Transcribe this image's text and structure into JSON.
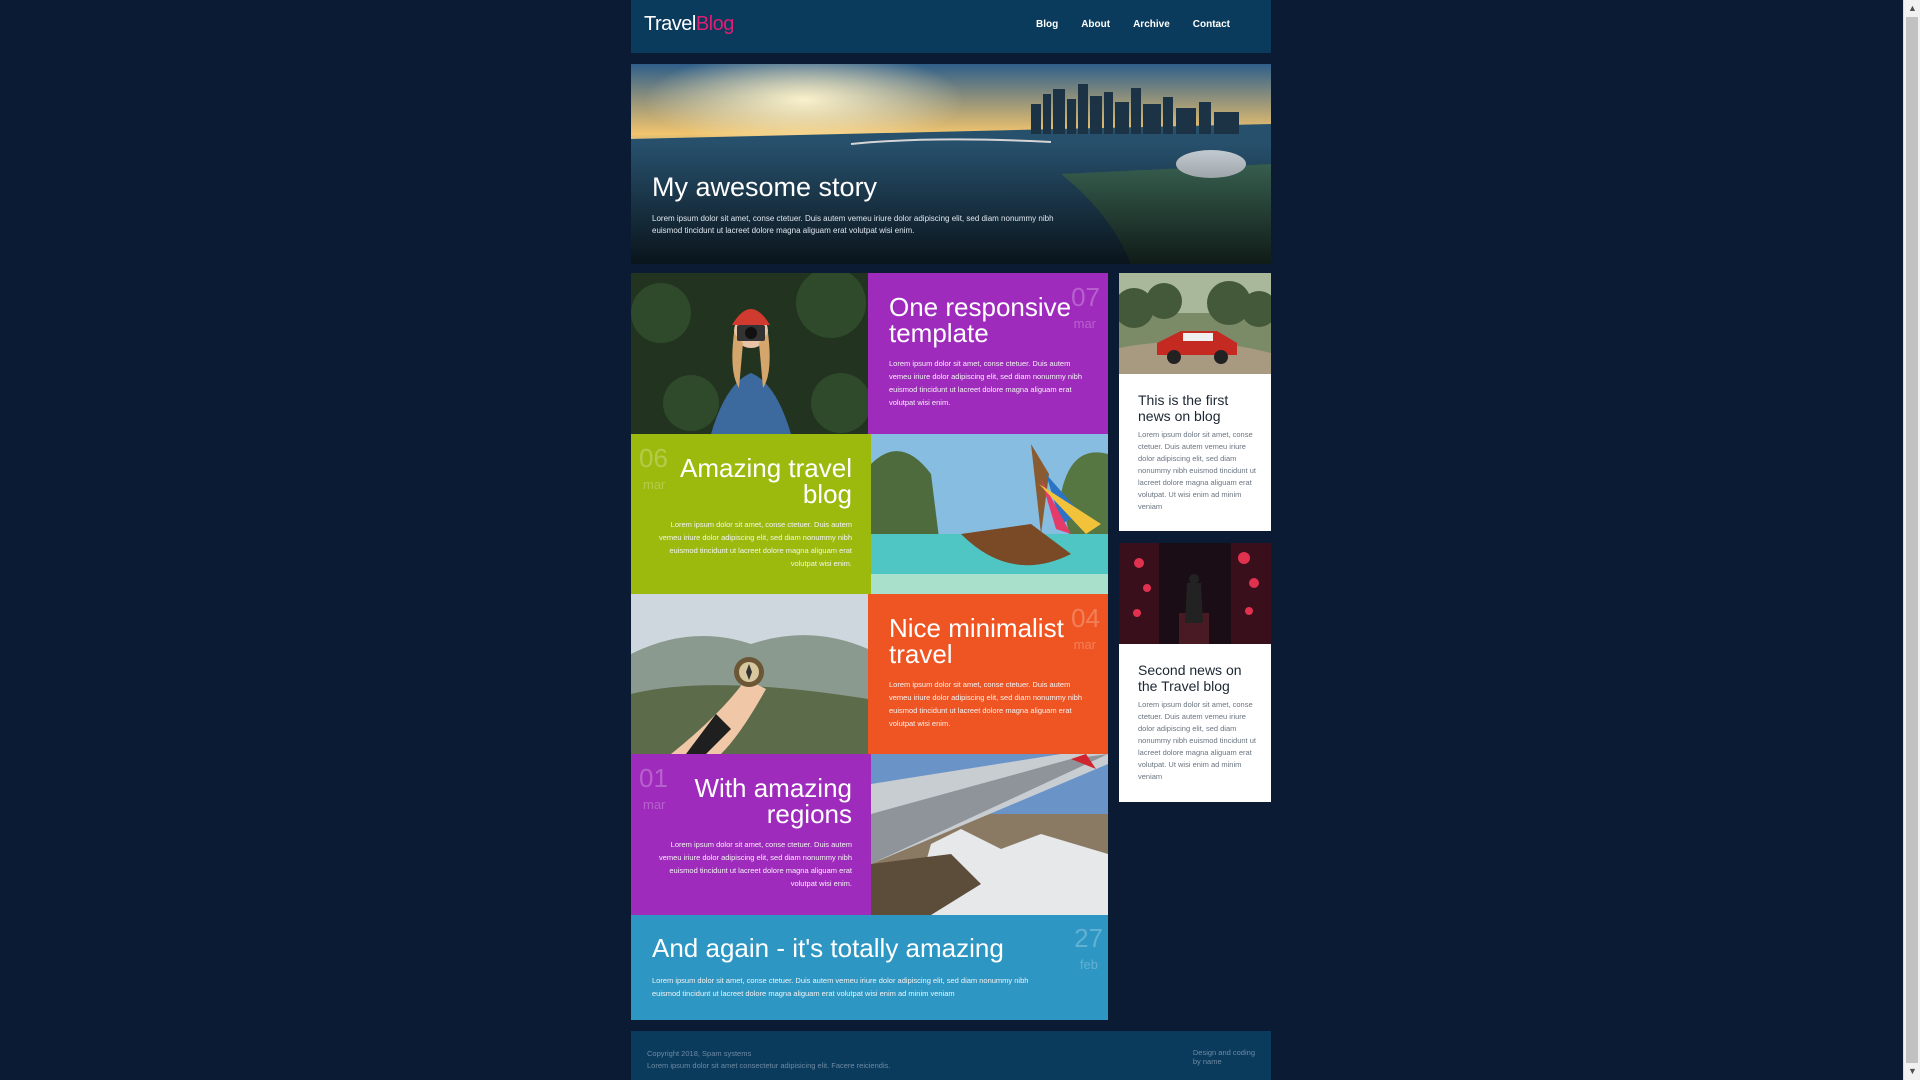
{
  "logo": {
    "part1": "Travel",
    "part2": "Blog"
  },
  "nav": [
    "Blog",
    "About",
    "Archive",
    "Contact"
  ],
  "hero": {
    "title": "My awesome story",
    "text": "Lorem ipsum dolor sit amet, conse ctetuer. Duis autem vemeu iriure dolor adipiscing elit, sed diam nonummy nibh euismod tincidunt ut lacreet dolore magna aliguam erat volutpat wisi enim."
  },
  "tiles": [
    {
      "title": "One responsive template",
      "day": "07",
      "month": "mar",
      "text": "Lorem ipsum dolor sit amet, conse ctetuer. Duis autem vemeu iriure dolor adipiscing elit, sed diam nonummy nibh euismod tincidunt ut lacreet dolore magna aliguam erat volutpat wisi enim.",
      "color": "#9f2bbd"
    },
    {
      "title": "Amazing travel blog",
      "day": "06",
      "month": "mar",
      "text": "Lorem ipsum dolor sit amet, conse ctetuer. Duis autem vemeu iriure dolor adipiscing elit, sed diam nonummy nibh euismod tincidunt ut lacreet dolore magna aliguam erat volutpat wisi enim.",
      "color": "#9cba0e"
    },
    {
      "title": "Nice minimalist travel",
      "day": "04",
      "month": "mar",
      "text": "Lorem ipsum dolor sit amet, conse ctetuer. Duis autem vemeu iriure dolor adipiscing elit, sed diam nonummy nibh euismod tincidunt ut lacreet dolore magna aliguam erat volutpat wisi enim.",
      "color": "#ef5523"
    },
    {
      "title": "With amazing regions",
      "day": "01",
      "month": "mar",
      "text": "Lorem ipsum dolor sit amet, conse ctetuer. Duis autem vemeu iriure dolor adipiscing elit, sed diam nonummy nibh euismod tincidunt ut lacreet dolore magna aliguam erat volutpat wisi enim.",
      "color": "#9f2bbd"
    },
    {
      "title": "And again - it's totally amazing",
      "day": "27",
      "month": "feb",
      "text": "Lorem ipsum dolor sit amet, conse ctetuer. Duis autem vemeu iriure dolor adipiscing elit, sed diam nonummy nibh euismod tincidunt ut lacreet dolore magna aliguam erat volutpat wisi enim ad minim veniam",
      "color": "#2e96c3"
    }
  ],
  "cards": [
    {
      "title": "This is the first news on blog",
      "text": "Lorem ipsum dolor sit amet, conse ctetuer. Duis autem vemeu iriure dolor adipiscing elit, sed diam nonummy nibh euismod tincidunt ut lacreet dolore magna aliguam erat volutpat. Ut wisi enim ad minim veniam"
    },
    {
      "title": "Second news on the Travel blog",
      "text": "Lorem ipsum dolor sit amet, conse ctetuer. Duis autem vemeu iriure dolor adipiscing elit, sed diam nonummy nibh euismod tincidunt ut lacreet dolore magna aliguam erat volutpat. Ut wisi enim ad minim veniam"
    }
  ],
  "footer": {
    "copyright": "Copyright 2018, Spam systems",
    "tagline": "Lorem ipsum dolor sit amet consectetur adipisicing elit. Facere reiciendis.",
    "credit_line1": "Design and coding",
    "credit_line2": "by name"
  },
  "colors": {
    "background": "#0b1b33",
    "header": "#0a3a5c",
    "accent": "#e11d74"
  }
}
